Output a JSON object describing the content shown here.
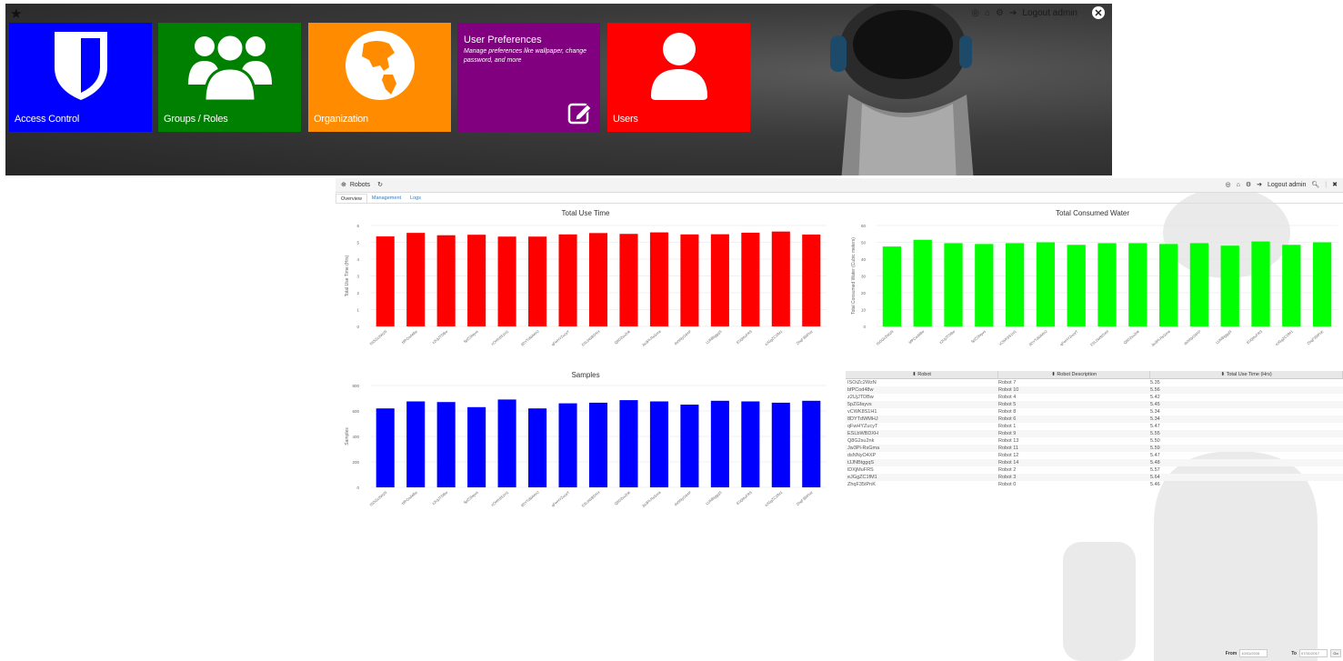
{
  "dashboard": {
    "topbar": {
      "logout_label": "Logout admin"
    },
    "tiles": [
      {
        "key": "access",
        "label": "Access Control",
        "color": "#0000ff",
        "icon": "shield-icon"
      },
      {
        "key": "groups",
        "label": "Groups / Roles",
        "color": "#008000",
        "icon": "users-group-icon"
      },
      {
        "key": "org",
        "label": "Organization",
        "color": "#ff8c00",
        "icon": "globe-icon"
      },
      {
        "key": "prefs",
        "title": "User Preferences",
        "description": "Manage preferences like wallpaper, change password, and more",
        "color": "#800080",
        "icon": "edit-icon"
      },
      {
        "key": "users",
        "label": "Users",
        "color": "#ff0000",
        "icon": "user-icon"
      }
    ]
  },
  "app": {
    "title": "Robots",
    "header": {
      "logout_label": "Logout admin"
    },
    "tabs": [
      {
        "label": "Overview",
        "active": true
      },
      {
        "label": "Management",
        "active": false
      },
      {
        "label": "Logs",
        "active": false
      }
    ],
    "table": {
      "headers": [
        "Robot",
        "Robot Description",
        "Total Use Time (Hrs)"
      ],
      "rows": [
        [
          "ISOiZc2WzN",
          "Robot 7",
          "5.35"
        ],
        [
          "bfPCod48w",
          "Robot 10",
          "5.56"
        ],
        [
          "z2UjJTDBw",
          "Robot 4",
          "5.42"
        ],
        [
          "5pZGfayvs",
          "Robot 5",
          "5.45"
        ],
        [
          "vCWK8S1H1",
          "Robot 8",
          "5.34"
        ],
        [
          "8DYTdWMHJ",
          "Robot 6",
          "5.34"
        ],
        [
          "qFwHYZucyT",
          "Robot 1",
          "5.47"
        ],
        [
          "ESLbWBDXH",
          "Robot 9",
          "5.55"
        ],
        [
          "Q8G2su2nk",
          "Robot 13",
          "5.50"
        ],
        [
          "Jw3Pl-RsGma",
          "Robot 11",
          "5.59"
        ],
        [
          "dsNNyO4XP",
          "Robot 12",
          "5.47"
        ],
        [
          "tJJNBtggqS",
          "Robot 14",
          "5.48"
        ],
        [
          "lDXjMuFRS",
          "Robot 2",
          "5.57"
        ],
        [
          "eJGgZC1fM1",
          "Robot 3",
          "5.64"
        ],
        [
          "ZhqF35tPnK",
          "Robot 0",
          "5.46"
        ]
      ]
    },
    "datebar": {
      "from_label": "From",
      "from_value": "10/31/2015",
      "to_label": "To",
      "to_value": "07/31/2017",
      "go_label": "Go"
    }
  },
  "chart_data": [
    {
      "type": "bar",
      "title": "Total Use Time",
      "ylabel": "Total Use Time (Hrs)",
      "color": "#ff0000",
      "ylim": [
        0,
        6
      ],
      "yticks": [
        "0",
        "1",
        "2",
        "3",
        "4",
        "5",
        "6"
      ],
      "categories": [
        "ISOiZc2WzN",
        "bfPCod48w",
        "z2UjJTDBw",
        "5pZGfayvs",
        "vCWK8S1H1",
        "8DYTdWMHJ",
        "qFwHYZucyT",
        "ESLbWBDXH",
        "Q8G2su2nk",
        "Jw3Pl-RsGma",
        "dsNNyO4XP",
        "tJJNBtggqS",
        "lDXjMuFRS",
        "eJGgZC1fM1",
        "ZhqF35tPnK"
      ],
      "values": [
        5.35,
        5.56,
        5.42,
        5.45,
        5.34,
        5.34,
        5.47,
        5.55,
        5.5,
        5.59,
        5.47,
        5.48,
        5.57,
        5.64,
        5.46
      ]
    },
    {
      "type": "bar",
      "title": "Total Consumed Water",
      "ylabel": "Total Consumed Water (Cubic meters)",
      "color": "#00ff00",
      "ylim": [
        0,
        60
      ],
      "yticks": [
        "0",
        "10",
        "20",
        "30",
        "40",
        "50",
        "60"
      ],
      "categories": [
        "ISOiZc2WzN",
        "bfPCod48w",
        "z2UjJTDBw",
        "5pZGfayvs",
        "vCWK8S1H1",
        "8DYTdWMHJ",
        "qFwHYZucyT",
        "ESLbWBDXH",
        "Q8G2su2nk",
        "Jw3Pl-RsGma",
        "dsNNyO4XP",
        "tJJNBtggqS",
        "lDXjMuFRS",
        "eJGgZC1fM1",
        "ZhqF35tPnK"
      ],
      "values": [
        47.5,
        51.5,
        49.5,
        49,
        49.5,
        50,
        48.5,
        49.5,
        49.5,
        49,
        49.5,
        48,
        50.5,
        48.5,
        50
      ]
    },
    {
      "type": "bar",
      "title": "Samples",
      "ylabel": "Samples",
      "color": "#0000ff",
      "ylim": [
        0,
        800
      ],
      "yticks": [
        "0",
        "200",
        "400",
        "600",
        "800"
      ],
      "categories": [
        "ISOiZc2WzN",
        "bfPCod48w",
        "z2UjJTDBw",
        "5pZGfayvs",
        "vCWK8S1H1",
        "8DYTdWMHJ",
        "qFwHYZucyT",
        "ESLbWBDXH",
        "Q8G2su2nk",
        "Jw3Pl-RsGma",
        "dsNNyO4XP",
        "tJJNBtggqS",
        "lDXjMuFRS",
        "eJGgZC1fM1",
        "ZhqF35tPnK"
      ],
      "values": [
        620,
        675,
        670,
        630,
        690,
        620,
        660,
        665,
        685,
        675,
        650,
        680,
        675,
        665,
        680
      ]
    }
  ]
}
